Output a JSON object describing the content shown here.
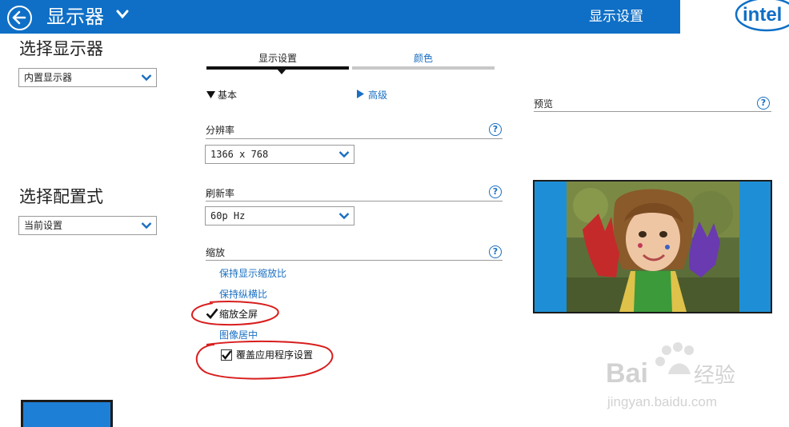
{
  "header": {
    "title": "显示器",
    "section": "显示设置",
    "logo_text": "intel",
    "bg_color": "#0f6fc6"
  },
  "left": {
    "select_display_heading": "选择显示器",
    "display_dropdown_value": "内置显示器",
    "select_profile_heading": "选择配置式",
    "profile_dropdown_value": "当前设置"
  },
  "tabs": [
    {
      "label": "显示设置",
      "active": true
    },
    {
      "label": "颜色",
      "active": false
    }
  ],
  "modes": {
    "basic": "基本",
    "advanced": "高级"
  },
  "resolution": {
    "label": "分辨率",
    "value": "1366 x 768"
  },
  "refresh": {
    "label": "刷新率",
    "value": "60p Hz"
  },
  "scaling": {
    "label": "缩放",
    "options": [
      {
        "label": "保持显示缩放比",
        "selected": false
      },
      {
        "label": "保持纵横比",
        "selected": false
      },
      {
        "label": "缩放全屏",
        "selected": true
      },
      {
        "label": "图像居中",
        "selected": false
      }
    ],
    "override_label": "覆盖应用程序设置",
    "override_checked": true
  },
  "preview": {
    "label": "预览"
  },
  "help_glyph": "?",
  "watermark": {
    "brand_prefix": "Bai",
    "brand_suffix": "经验",
    "url": "jingyan.baidu.com"
  },
  "colors": {
    "accent": "#0f6fc6",
    "link": "#1a6fc2",
    "annotation": "#d81e1e"
  }
}
